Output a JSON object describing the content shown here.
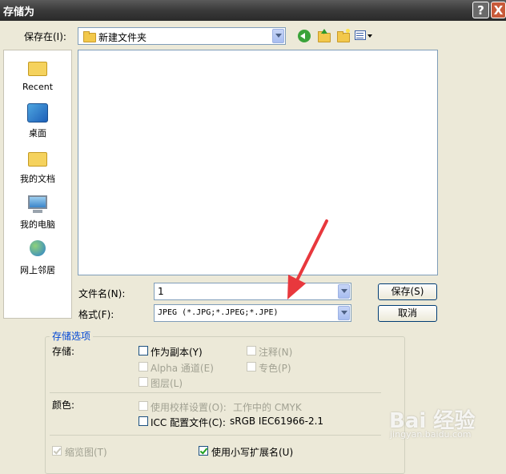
{
  "window": {
    "title": "存储为",
    "help": "?",
    "close": "X"
  },
  "save_in": {
    "label": "保存在(I):",
    "value": "新建文件夹"
  },
  "places": [
    {
      "label": "Recent",
      "icon": "recent-folder-icon"
    },
    {
      "label": "桌面",
      "icon": "desktop-icon"
    },
    {
      "label": "我的文档",
      "icon": "my-documents-icon"
    },
    {
      "label": "我的电脑",
      "icon": "my-computer-icon"
    },
    {
      "label": "网上邻居",
      "icon": "network-icon"
    }
  ],
  "filename": {
    "label": "文件名(N):",
    "value": "1"
  },
  "format": {
    "label": "格式(F):",
    "value": "JPEG (*.JPG;*.JPEG;*.JPE)"
  },
  "buttons": {
    "save": "保存(S)",
    "cancel": "取消"
  },
  "options": {
    "legend": "存储选项",
    "storage_label": "存储:",
    "as_copy": "作为副本(Y)",
    "annotations": "注释(N)",
    "alpha": "Alpha 通道(E)",
    "spot": "专色(P)",
    "layers": "图层(L)",
    "color_label": "颜色:",
    "proof": "使用校样设置(O):",
    "proof_value": "工作中的 CMYK",
    "icc": "ICC 配置文件(C):",
    "icc_value": "sRGB IEC61966-2.1",
    "thumbnail": "缩览图(T)",
    "lowercase_ext": "使用小写扩展名(U)"
  },
  "watermark": {
    "main": "Bai 经验",
    "sub": "jingyan.baidu.com"
  },
  "colors": {
    "accent_arrow": "#e8383d",
    "legend_blue": "#0046d5"
  }
}
